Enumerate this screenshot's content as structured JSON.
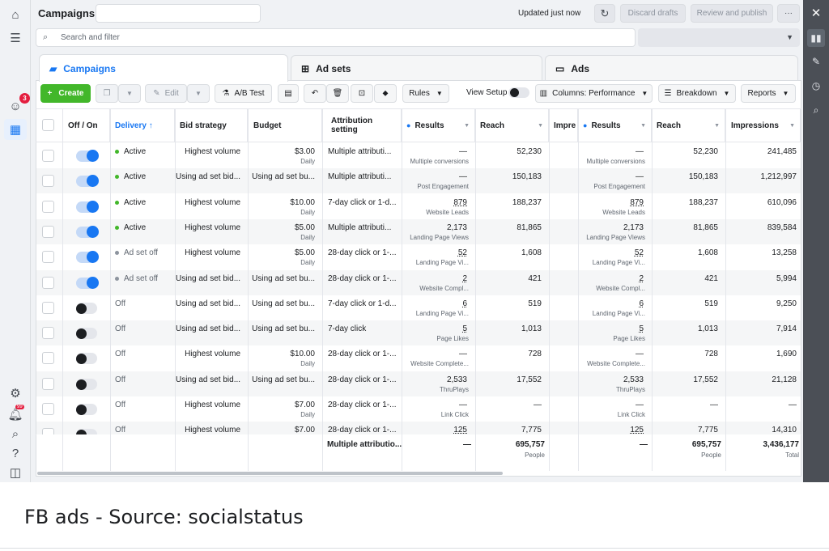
{
  "header": {
    "title": "Campaigns",
    "updated": "Updated just now",
    "discard": "Discard drafts",
    "review": "Review and publish",
    "more": "···"
  },
  "search": {
    "placeholder": "Search and filter"
  },
  "tabs": [
    {
      "label": "Campaigns"
    },
    {
      "label": "Ad sets"
    },
    {
      "label": "Ads"
    }
  ],
  "notifications": {
    "count": "3",
    "alerts": "99"
  },
  "toolbar": {
    "create": "Create",
    "edit": "Edit",
    "ab_test": "A/B Test",
    "rules": "Rules",
    "view_setup": "View Setup",
    "columns": "Columns: Performance",
    "breakdown": "Breakdown",
    "reports": "Reports"
  },
  "columns": {
    "onoff": "Off / On",
    "delivery": "Delivery ↑",
    "bid": "Bid strategy",
    "budget": "Budget",
    "attribution": "Attribution setting",
    "results": "Results",
    "reach": "Reach",
    "impre_short": "Impre",
    "results2": "Results",
    "reach2": "Reach",
    "impressions": "Impressions"
  },
  "rows": [
    {
      "delivery": "Active",
      "bid": "Highest volume",
      "budget": "$3.00",
      "budget_sub": "Daily",
      "attr": "Multiple attributi...",
      "result": "—",
      "result_sub": "Multiple conversions",
      "reach": "52,230",
      "impressions": "241,485"
    },
    {
      "delivery": "Active",
      "bid": "Using ad set bid...",
      "budget": "Using ad set bu...",
      "budget_sub": "",
      "attr": "Multiple attributi...",
      "result": "—",
      "result_sub": "Post Engagement",
      "reach": "150,183",
      "impressions": "1,212,997"
    },
    {
      "delivery": "Active",
      "bid": "Highest volume",
      "budget": "$10.00",
      "budget_sub": "Daily",
      "attr": "7-day click or 1-d...",
      "result": "879",
      "result_sub": "Website Leads",
      "reach": "188,237",
      "impressions": "610,096"
    },
    {
      "delivery": "Active",
      "bid": "Highest volume",
      "budget": "$5.00",
      "budget_sub": "Daily",
      "attr": "Multiple attributi...",
      "result": "2,173",
      "result_sub": "Landing Page Views",
      "reach": "81,865",
      "impressions": "839,584"
    },
    {
      "delivery": "Ad set off",
      "bid": "Highest volume",
      "budget": "$5.00",
      "budget_sub": "Daily",
      "attr": "28-day click or 1-...",
      "result": "52",
      "result_sub": "Landing Page Vi...",
      "reach": "1,608",
      "impressions": "13,258"
    },
    {
      "delivery": "Ad set off",
      "bid": "Using ad set bid...",
      "budget": "Using ad set bu...",
      "budget_sub": "",
      "attr": "28-day click or 1-...",
      "result": "2",
      "result_sub": "Website Compl...",
      "reach": "421",
      "impressions": "5,994"
    },
    {
      "delivery": "Off",
      "bid": "Using ad set bid...",
      "budget": "Using ad set bu...",
      "budget_sub": "",
      "attr": "7-day click or 1-d...",
      "result": "6",
      "result_sub": "Landing Page Vi...",
      "reach": "519",
      "impressions": "9,250"
    },
    {
      "delivery": "Off",
      "bid": "Using ad set bid...",
      "budget": "Using ad set bu...",
      "budget_sub": "",
      "attr": "7-day click",
      "result": "5",
      "result_sub": "Page Likes",
      "reach": "1,013",
      "impressions": "7,914"
    },
    {
      "delivery": "Off",
      "bid": "Highest volume",
      "budget": "$10.00",
      "budget_sub": "Daily",
      "attr": "28-day click or 1-...",
      "result": "—",
      "result_sub": "Website Complete...",
      "reach": "728",
      "impressions": "1,690"
    },
    {
      "delivery": "Off",
      "bid": "Using ad set bid...",
      "budget": "Using ad set bu...",
      "budget_sub": "",
      "attr": "28-day click or 1-...",
      "result": "2,533",
      "result_sub": "ThruPlays",
      "reach": "17,552",
      "impressions": "21,128"
    },
    {
      "delivery": "Off",
      "bid": "Highest volume",
      "budget": "$7.00",
      "budget_sub": "Daily",
      "attr": "28-day click or 1-...",
      "result": "—",
      "result_sub": "Link Click",
      "reach": "—",
      "impressions": "—"
    },
    {
      "delivery": "Off",
      "bid": "Highest volume",
      "budget": "$7.00",
      "budget_sub": "",
      "attr": "28-day click or 1-...",
      "result": "125",
      "result_sub": "",
      "reach": "7,775",
      "impressions": "14,310"
    }
  ],
  "totals": {
    "attr": "Multiple attributio...",
    "result": "—",
    "reach": "695,757",
    "reach_sub": "People",
    "impressions": "3,436,177",
    "impressions_sub": "Total"
  },
  "caption": "FB ads - Source: socialstatus",
  "colors": {
    "accent": "#1877f2",
    "create": "#42b72a",
    "active_dot": "#42b72a",
    "off_dot": "#8d949e"
  }
}
